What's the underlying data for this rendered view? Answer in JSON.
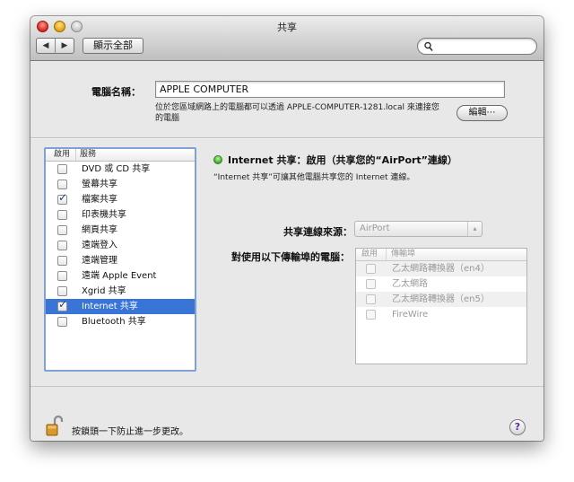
{
  "window": {
    "title": "共享"
  },
  "toolbar": {
    "back_glyph": "◀",
    "forward_glyph": "▶",
    "show_all_label": "顯示全部",
    "search_placeholder": ""
  },
  "computer_name": {
    "label": "電腦名稱：",
    "value": "APPLE COMPUTER",
    "description": "位於您區域網路上的電腦都可以透過 APPLE-COMPUTER-1281.local 來連接您的電腦",
    "edit_label": "編輯⋯"
  },
  "services": {
    "header_enable": "啟用",
    "header_service": "服務",
    "items": [
      {
        "label": "DVD 或 CD 共享",
        "checked": false,
        "selected": false
      },
      {
        "label": "螢幕共享",
        "checked": false,
        "selected": false
      },
      {
        "label": "檔案共享",
        "checked": true,
        "selected": false
      },
      {
        "label": "印表機共享",
        "checked": false,
        "selected": false
      },
      {
        "label": "網頁共享",
        "checked": false,
        "selected": false
      },
      {
        "label": "遠端登入",
        "checked": false,
        "selected": false
      },
      {
        "label": "遠端管理",
        "checked": false,
        "selected": false
      },
      {
        "label": "遠端 Apple Event",
        "checked": false,
        "selected": false
      },
      {
        "label": "Xgrid 共享",
        "checked": false,
        "selected": false
      },
      {
        "label": "Internet 共享",
        "checked": true,
        "selected": true
      },
      {
        "label": "Bluetooth 共享",
        "checked": false,
        "selected": false
      }
    ]
  },
  "detail": {
    "status": "Internet 共享：啟用（共享您的“AirPort”連線）",
    "status_color": "#2fa51a",
    "description": "“Internet 共享”可讓其他電腦共享您的 Internet 連線。",
    "share_from_label": "共享連線來源：",
    "share_from_value": "AirPort",
    "ports_label": "對使用以下傳輸埠的電腦：",
    "ports_header_enable": "啟用",
    "ports_header_port": "傳輸埠",
    "ports": [
      {
        "label": "乙太網路轉換器（en4）",
        "checked": false
      },
      {
        "label": "乙太網路",
        "checked": false
      },
      {
        "label": "乙太網路轉換器（en5）",
        "checked": false
      },
      {
        "label": "FireWire",
        "checked": false
      }
    ]
  },
  "footer": {
    "lock_text": "按鎖頭一下防止進一步更改。",
    "help_glyph": "?"
  },
  "colors": {
    "selection": "#3875d7",
    "focus_ring": "#7ea2d6"
  }
}
